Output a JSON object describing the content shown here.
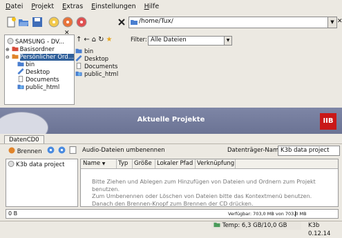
{
  "menu": [
    "Datei",
    "Projekt",
    "Extras",
    "Einstellungen",
    "Hilfe"
  ],
  "path": "/home/Tux/",
  "tree": {
    "items": [
      {
        "label": "SAMSUNG - DV...",
        "icon": "cd-drive-icon"
      },
      {
        "label": "Basisordner",
        "icon": "home-folder-icon"
      },
      {
        "label": "Persönlicher Ord...",
        "icon": "home-folder-icon"
      },
      {
        "label": "bin",
        "icon": "folder-icon"
      },
      {
        "label": "Desktop",
        "icon": "desktop-icon"
      },
      {
        "label": "Documents",
        "icon": "document-icon"
      },
      {
        "label": "public_html",
        "icon": "web-folder-icon"
      }
    ]
  },
  "filter": {
    "label": "Filter:",
    "value": "Alle Dateien"
  },
  "files": [
    "bin",
    "Desktop",
    "Documents",
    "public_html"
  ],
  "banner": {
    "title": "Aktuelle Projekte",
    "logo": "IIB"
  },
  "tab": "DatenCD0",
  "project_toolbar": {
    "burn": "Brennen",
    "rename_audio": "Audio-Dateien umbenennen",
    "volume_label": "Datenträger-Name:",
    "volume_value": "K3b data project"
  },
  "project_tree_root": "K3b data project",
  "columns": [
    "Name",
    "Typ",
    "Größe",
    "Lokaler Pfad",
    "Verknüpfung"
  ],
  "help_lines": [
    "Bitte Ziehen und Ablegen zum Hinzufügen von Dateien und Ordnern zum Projekt benutzen.",
    "Zum Umbenennen oder Löschen von Dateien bitte das Kontextmenü benutzen.",
    "Danach den Brennen-Knopf zum Brennen der CD drücken."
  ],
  "capacity": {
    "used": "0 B",
    "available": "Verfügbar: 703,0 MB von 703,0 MB"
  },
  "status": {
    "temp": "Temp: 6,3 GB/10,0 GB",
    "version": "K3b 0.12.14"
  },
  "colors": {
    "selection": "#2f5f9a",
    "banner": "#747c9c",
    "logo": "#c91818"
  }
}
